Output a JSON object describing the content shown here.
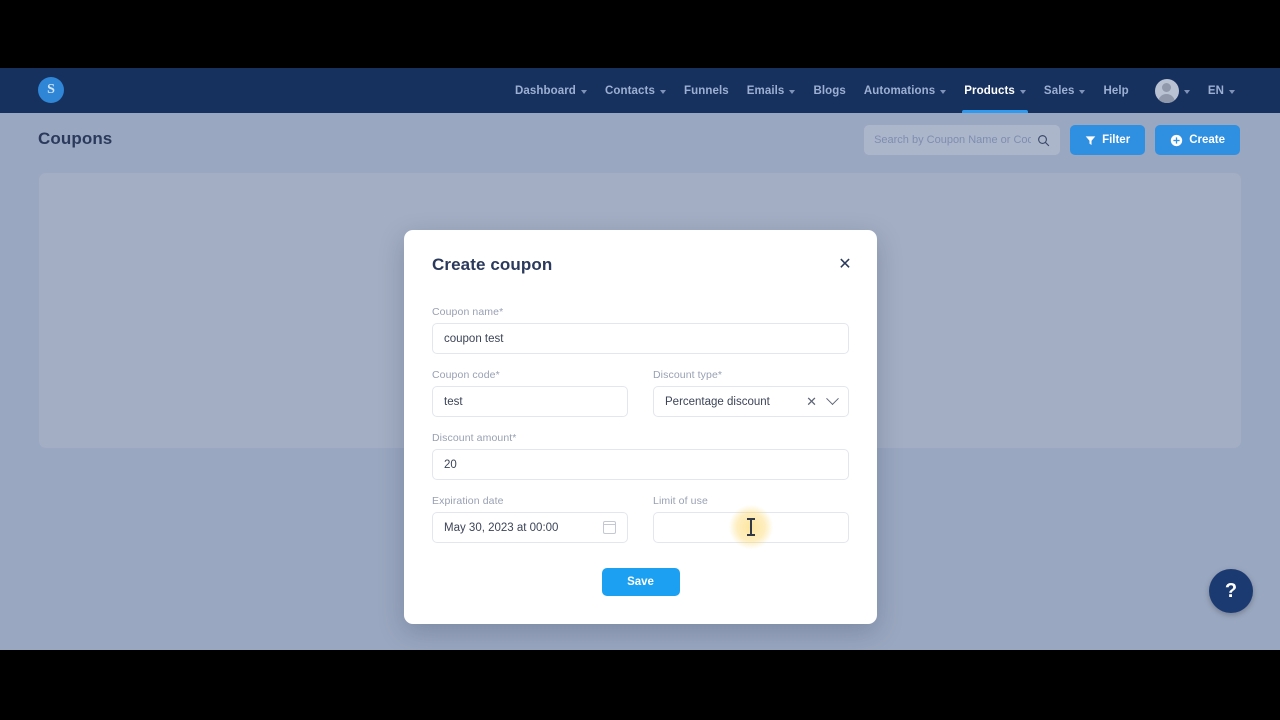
{
  "topnav": {
    "logo_letter": "S",
    "items": [
      {
        "label": "Dashboard",
        "has_caret": true,
        "active": false
      },
      {
        "label": "Contacts",
        "has_caret": true,
        "active": false
      },
      {
        "label": "Funnels",
        "has_caret": false,
        "active": false
      },
      {
        "label": "Emails",
        "has_caret": true,
        "active": false
      },
      {
        "label": "Blogs",
        "has_caret": false,
        "active": false
      },
      {
        "label": "Automations",
        "has_caret": true,
        "active": false
      },
      {
        "label": "Products",
        "has_caret": true,
        "active": true
      },
      {
        "label": "Sales",
        "has_caret": true,
        "active": false
      },
      {
        "label": "Help",
        "has_caret": false,
        "active": false
      }
    ],
    "language": "EN",
    "accent_color": "#2e9bf0",
    "bar_color": "#17315f"
  },
  "header": {
    "title": "Coupons",
    "search_placeholder": "Search by Coupon Name or Code",
    "search_value": "",
    "filter_label": "Filter",
    "create_label": "Create",
    "button_color": "#2f8fe0"
  },
  "help": {
    "glyph": "?"
  },
  "modal": {
    "title": "Create coupon",
    "close_glyph": "✕",
    "fields": {
      "coupon_name": {
        "label": "Coupon name",
        "required_mark": "*",
        "value": "coupon test"
      },
      "coupon_code": {
        "label": "Coupon code",
        "required_mark": "*",
        "value": "test"
      },
      "discount_type": {
        "label": "Discount type",
        "required_mark": "*",
        "value": "Percentage discount",
        "clear_glyph": "✕"
      },
      "discount_amount": {
        "label": "Discount amount",
        "required_mark": "*",
        "value": "20"
      },
      "expiration_date": {
        "label": "Expiration date",
        "required_mark": "",
        "value": "May 30, 2023 at 00:00"
      },
      "limit_of_use": {
        "label": "Limit of use",
        "required_mark": "",
        "value": "",
        "placeholder": ""
      }
    },
    "save_label": "Save",
    "save_color": "#1ba0f2"
  }
}
